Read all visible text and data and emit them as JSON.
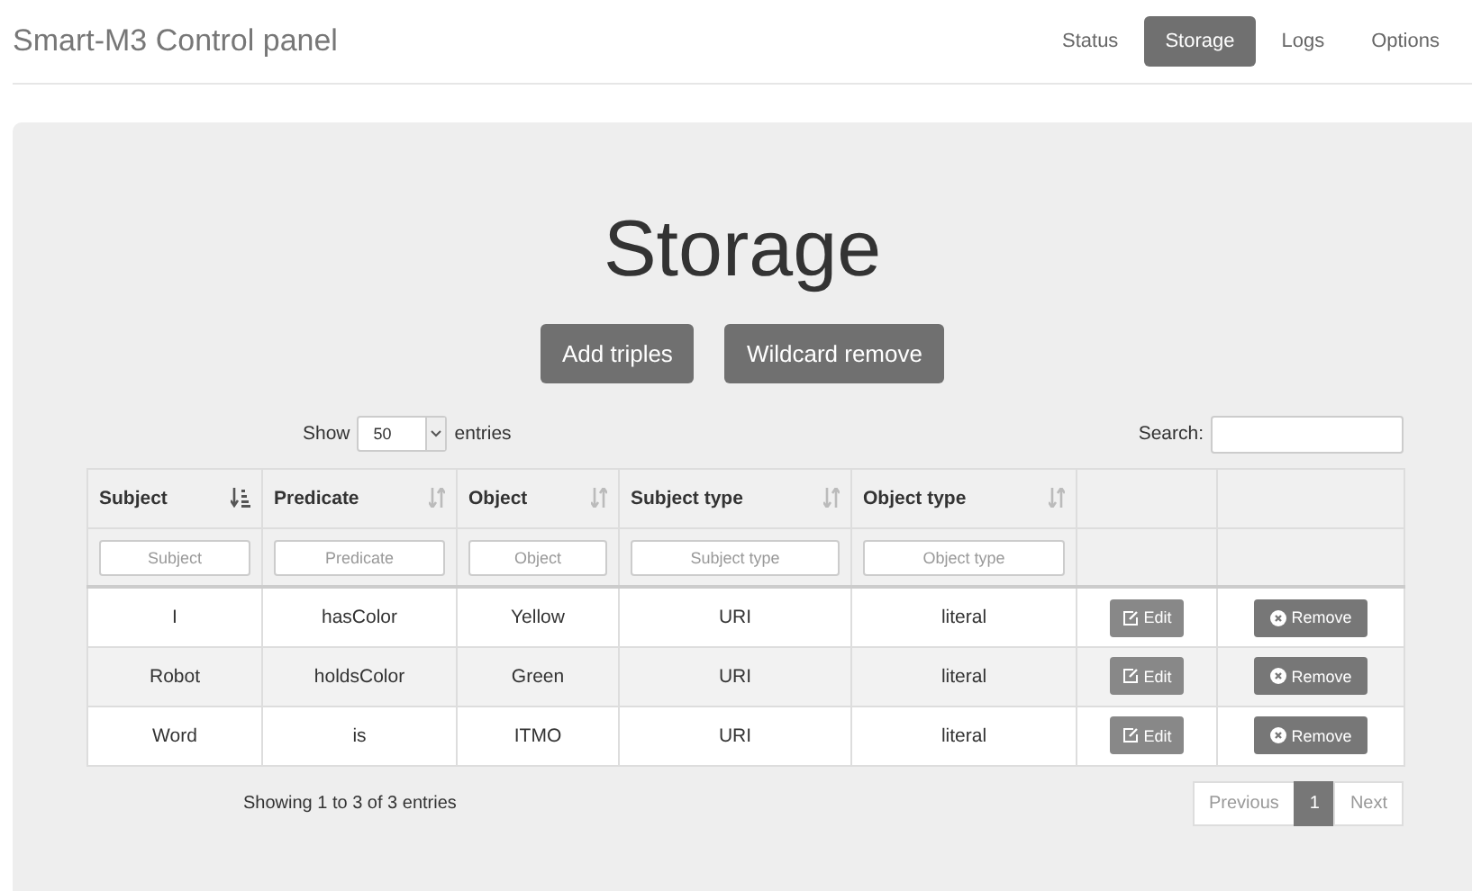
{
  "brand": "Smart-M3 Control panel",
  "nav": [
    {
      "label": "Status",
      "selected": false
    },
    {
      "label": "Storage",
      "selected": true
    },
    {
      "label": "Logs",
      "selected": false
    },
    {
      "label": "Options",
      "selected": false
    }
  ],
  "heading": "Storage",
  "actions": [
    "Add triples",
    "Wildcard remove"
  ],
  "length_menu": {
    "before": "Show",
    "value": "50",
    "after": "entries"
  },
  "search": {
    "label": "Search:"
  },
  "table": {
    "columns": [
      {
        "label": "Subject",
        "sorted": true,
        "placeholder": "Subject"
      },
      {
        "label": "Predicate",
        "sorted": false,
        "placeholder": "Predicate"
      },
      {
        "label": "Object",
        "sorted": false,
        "placeholder": "Object"
      },
      {
        "label": "Subject type",
        "sorted": false,
        "placeholder": "Subject type"
      },
      {
        "label": "Object type",
        "sorted": false,
        "placeholder": "Object type"
      }
    ],
    "rows": [
      {
        "cells": [
          "I",
          "hasColor",
          "Yellow",
          "URI",
          "literal"
        ],
        "edit": "Edit",
        "remove": "Remove"
      },
      {
        "cells": [
          "Robot",
          "holdsColor",
          "Green",
          "URI",
          "literal"
        ],
        "edit": "Edit",
        "remove": "Remove"
      },
      {
        "cells": [
          "Word",
          "is",
          "ITMO",
          "URI",
          "literal"
        ],
        "edit": "Edit",
        "remove": "Remove"
      }
    ]
  },
  "info": "Showing 1 to 3 of 3 entries",
  "pagination": [
    {
      "label": "Previous",
      "selected": false
    },
    {
      "label": "1",
      "selected": true
    },
    {
      "label": "Next",
      "selected": false
    }
  ]
}
